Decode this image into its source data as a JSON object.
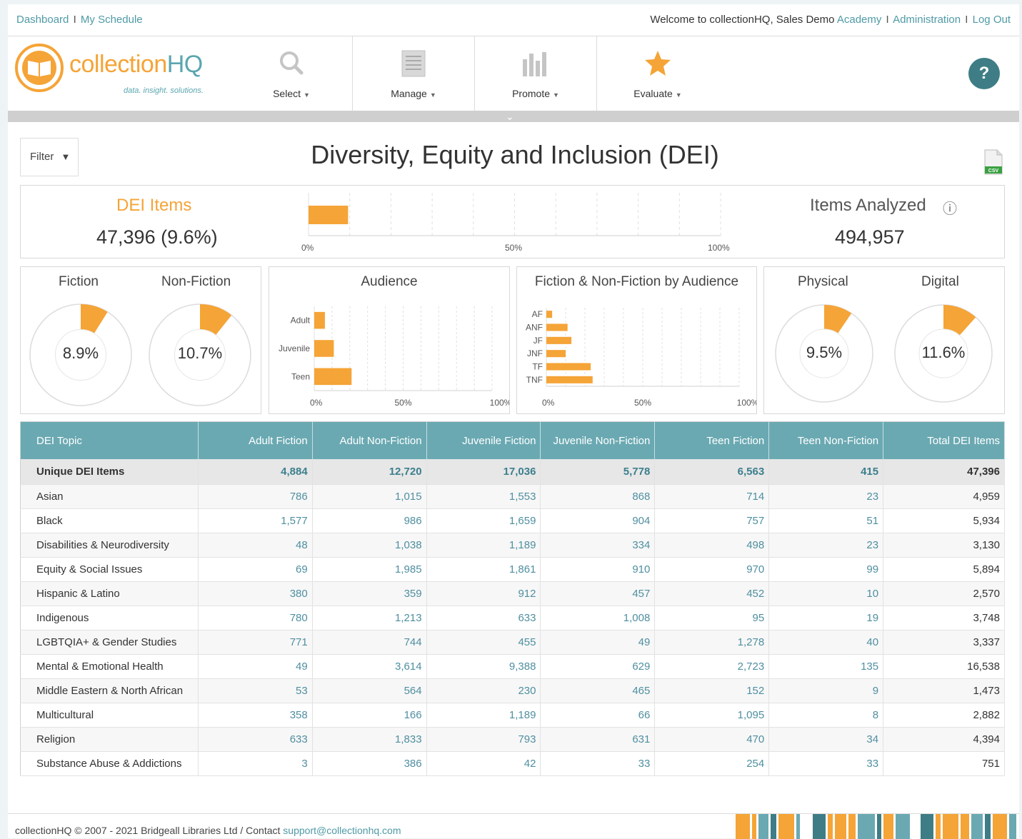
{
  "topnav": {
    "dashboard": "Dashboard",
    "my_schedule": "My Schedule",
    "welcome": "Welcome to collectionHQ, Sales Demo",
    "academy": "Academy",
    "administration": "Administration",
    "logout": "Log Out",
    "sep": "I"
  },
  "logo": {
    "part1": "collection",
    "part2": "HQ",
    "tagline": "data. insight. solutions."
  },
  "nav": [
    {
      "label": "Select",
      "icon": "search-icon"
    },
    {
      "label": "Manage",
      "icon": "document-icon"
    },
    {
      "label": "Promote",
      "icon": "bar-chart-icon"
    },
    {
      "label": "Evaluate",
      "icon": "star-icon"
    }
  ],
  "help": "?",
  "filter": {
    "label": "Filter",
    "caret": "▼"
  },
  "title": "Diversity, Equity and Inclusion (DEI)",
  "csv_label": "CSV",
  "summary": {
    "dei_label": "DEI Items",
    "dei_value": "47,396 (9.6%)",
    "dei_percent": 9.6,
    "analyzed_label": "Items Analyzed",
    "analyzed_value": "494,957",
    "info": "ⓘ",
    "axis": [
      "0%",
      "50%",
      "100%"
    ]
  },
  "donuts_left": {
    "fiction": {
      "label": "Fiction",
      "value": "8.9%",
      "percent": 8.9
    },
    "nonfiction": {
      "label": "Non-Fiction",
      "value": "10.7%",
      "percent": 10.7
    }
  },
  "donuts_right": {
    "physical": {
      "label": "Physical",
      "value": "9.5%",
      "percent": 9.5
    },
    "digital": {
      "label": "Digital",
      "value": "11.6%",
      "percent": 11.6
    }
  },
  "audience": {
    "title": "Audience",
    "categories": [
      "Adult",
      "Juvenile",
      "Teen"
    ],
    "values": [
      6,
      11,
      21
    ],
    "axis": [
      "0%",
      "50%",
      "100%"
    ]
  },
  "fnf_audience": {
    "title": "Fiction & Non-Fiction by Audience",
    "categories": [
      "AF",
      "ANF",
      "JF",
      "JNF",
      "TF",
      "TNF"
    ],
    "values": [
      3,
      11,
      13,
      10,
      23,
      24
    ],
    "axis": [
      "0%",
      "50%",
      "100%"
    ]
  },
  "table": {
    "headers": [
      "DEI Topic",
      "Adult Fiction",
      "Adult Non-Fiction",
      "Juvenile Fiction",
      "Juvenile Non-Fiction",
      "Teen Fiction",
      "Teen Non-Fiction",
      "Total DEI Items"
    ],
    "unique": [
      "Unique DEI Items",
      "4,884",
      "12,720",
      "17,036",
      "5,778",
      "6,563",
      "415",
      "47,396"
    ],
    "rows": [
      [
        "Asian",
        "786",
        "1,015",
        "1,553",
        "868",
        "714",
        "23",
        "4,959"
      ],
      [
        "Black",
        "1,577",
        "986",
        "1,659",
        "904",
        "757",
        "51",
        "5,934"
      ],
      [
        "Disabilities & Neurodiversity",
        "48",
        "1,038",
        "1,189",
        "334",
        "498",
        "23",
        "3,130"
      ],
      [
        "Equity & Social Issues",
        "69",
        "1,985",
        "1,861",
        "910",
        "970",
        "99",
        "5,894"
      ],
      [
        "Hispanic & Latino",
        "380",
        "359",
        "912",
        "457",
        "452",
        "10",
        "2,570"
      ],
      [
        "Indigenous",
        "780",
        "1,213",
        "633",
        "1,008",
        "95",
        "19",
        "3,748"
      ],
      [
        "LGBTQIA+ & Gender Studies",
        "771",
        "744",
        "455",
        "49",
        "1,278",
        "40",
        "3,337"
      ],
      [
        "Mental & Emotional Health",
        "49",
        "3,614",
        "9,388",
        "629",
        "2,723",
        "135",
        "16,538"
      ],
      [
        "Middle Eastern & North African",
        "53",
        "564",
        "230",
        "465",
        "152",
        "9",
        "1,473"
      ],
      [
        "Multicultural",
        "358",
        "166",
        "1,189",
        "66",
        "1,095",
        "8",
        "2,882"
      ],
      [
        "Religion",
        "633",
        "1,833",
        "793",
        "631",
        "470",
        "34",
        "4,394"
      ],
      [
        "Substance Abuse & Addictions",
        "3",
        "386",
        "42",
        "33",
        "254",
        "33",
        "751"
      ]
    ]
  },
  "footer": {
    "text": "collectionHQ © 2007 - 2021  Bridgeall Libraries Ltd / Contact",
    "email": "support@collectionhq.com"
  },
  "colors": {
    "accent": "#f5a437",
    "teal": "#6aa9b2",
    "dark_teal": "#3e7d86"
  }
}
